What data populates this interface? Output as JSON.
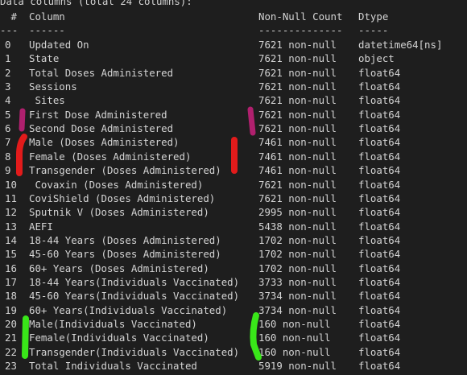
{
  "header_text": "Data columns (total 24 columns):",
  "table_headers": {
    "idx": " #",
    "column": "Column",
    "non_null": "Non-Null Count",
    "dtype": "Dtype"
  },
  "separators": {
    "idx": "---",
    "column": "------",
    "non_null": "--------------",
    "dtype": "-----"
  },
  "rows": [
    {
      "idx": "0",
      "column": "Updated On",
      "non_null": "7621 non-null",
      "dtype": "datetime64[ns]"
    },
    {
      "idx": "1",
      "column": "State",
      "non_null": "7621 non-null",
      "dtype": "object"
    },
    {
      "idx": "2",
      "column": "Total Doses Administered",
      "non_null": "7621 non-null",
      "dtype": "float64"
    },
    {
      "idx": "3",
      "column": "Sessions",
      "non_null": "7621 non-null",
      "dtype": "float64"
    },
    {
      "idx": "4",
      "column": " Sites",
      "non_null": "7621 non-null",
      "dtype": "float64"
    },
    {
      "idx": "5",
      "column": "First Dose Administered",
      "non_null": "7621 non-null",
      "dtype": "float64"
    },
    {
      "idx": "6",
      "column": "Second Dose Administered",
      "non_null": "7621 non-null",
      "dtype": "float64"
    },
    {
      "idx": "7",
      "column": "Male (Doses Administered)",
      "non_null": "7461 non-null",
      "dtype": "float64"
    },
    {
      "idx": "8",
      "column": "Female (Doses Administered)",
      "non_null": "7461 non-null",
      "dtype": "float64"
    },
    {
      "idx": "9",
      "column": "Transgender (Doses Administered)",
      "non_null": "7461 non-null",
      "dtype": "float64"
    },
    {
      "idx": "10",
      "column": " Covaxin (Doses Administered)",
      "non_null": "7621 non-null",
      "dtype": "float64"
    },
    {
      "idx": "11",
      "column": "CoviShield (Doses Administered)",
      "non_null": "7621 non-null",
      "dtype": "float64"
    },
    {
      "idx": "12",
      "column": "Sputnik V (Doses Administered)",
      "non_null": "2995 non-null",
      "dtype": "float64"
    },
    {
      "idx": "13",
      "column": "AEFI",
      "non_null": "5438 non-null",
      "dtype": "float64"
    },
    {
      "idx": "14",
      "column": "18-44 Years (Doses Administered)",
      "non_null": "1702 non-null",
      "dtype": "float64"
    },
    {
      "idx": "15",
      "column": "45-60 Years (Doses Administered)",
      "non_null": "1702 non-null",
      "dtype": "float64"
    },
    {
      "idx": "16",
      "column": "60+ Years (Doses Administered)",
      "non_null": "1702 non-null",
      "dtype": "float64"
    },
    {
      "idx": "17",
      "column": "18-44 Years(Individuals Vaccinated)",
      "non_null": "3733 non-null",
      "dtype": "float64"
    },
    {
      "idx": "18",
      "column": "45-60 Years(Individuals Vaccinated)",
      "non_null": "3734 non-null",
      "dtype": "float64"
    },
    {
      "idx": "19",
      "column": "60+ Years(Individuals Vaccinated)",
      "non_null": "3734 non-null",
      "dtype": "float64"
    },
    {
      "idx": "20",
      "column": "Male(Individuals Vaccinated)",
      "non_null": "160 non-null",
      "dtype": "float64"
    },
    {
      "idx": "21",
      "column": "Female(Individuals Vaccinated)",
      "non_null": "160 non-null",
      "dtype": "float64"
    },
    {
      "idx": "22",
      "column": "Transgender(Individuals Vaccinated)",
      "non_null": "160 non-null",
      "dtype": "float64"
    },
    {
      "idx": "23",
      "column": "Total Individuals Vaccinated",
      "non_null": "5919 non-null",
      "dtype": "float64"
    }
  ],
  "colors": {
    "background": "#1e1e1e",
    "text": "#d4d4d4",
    "highlight_purple": "#b0206e",
    "highlight_red": "#e21b1b",
    "highlight_green": "#39e619"
  }
}
